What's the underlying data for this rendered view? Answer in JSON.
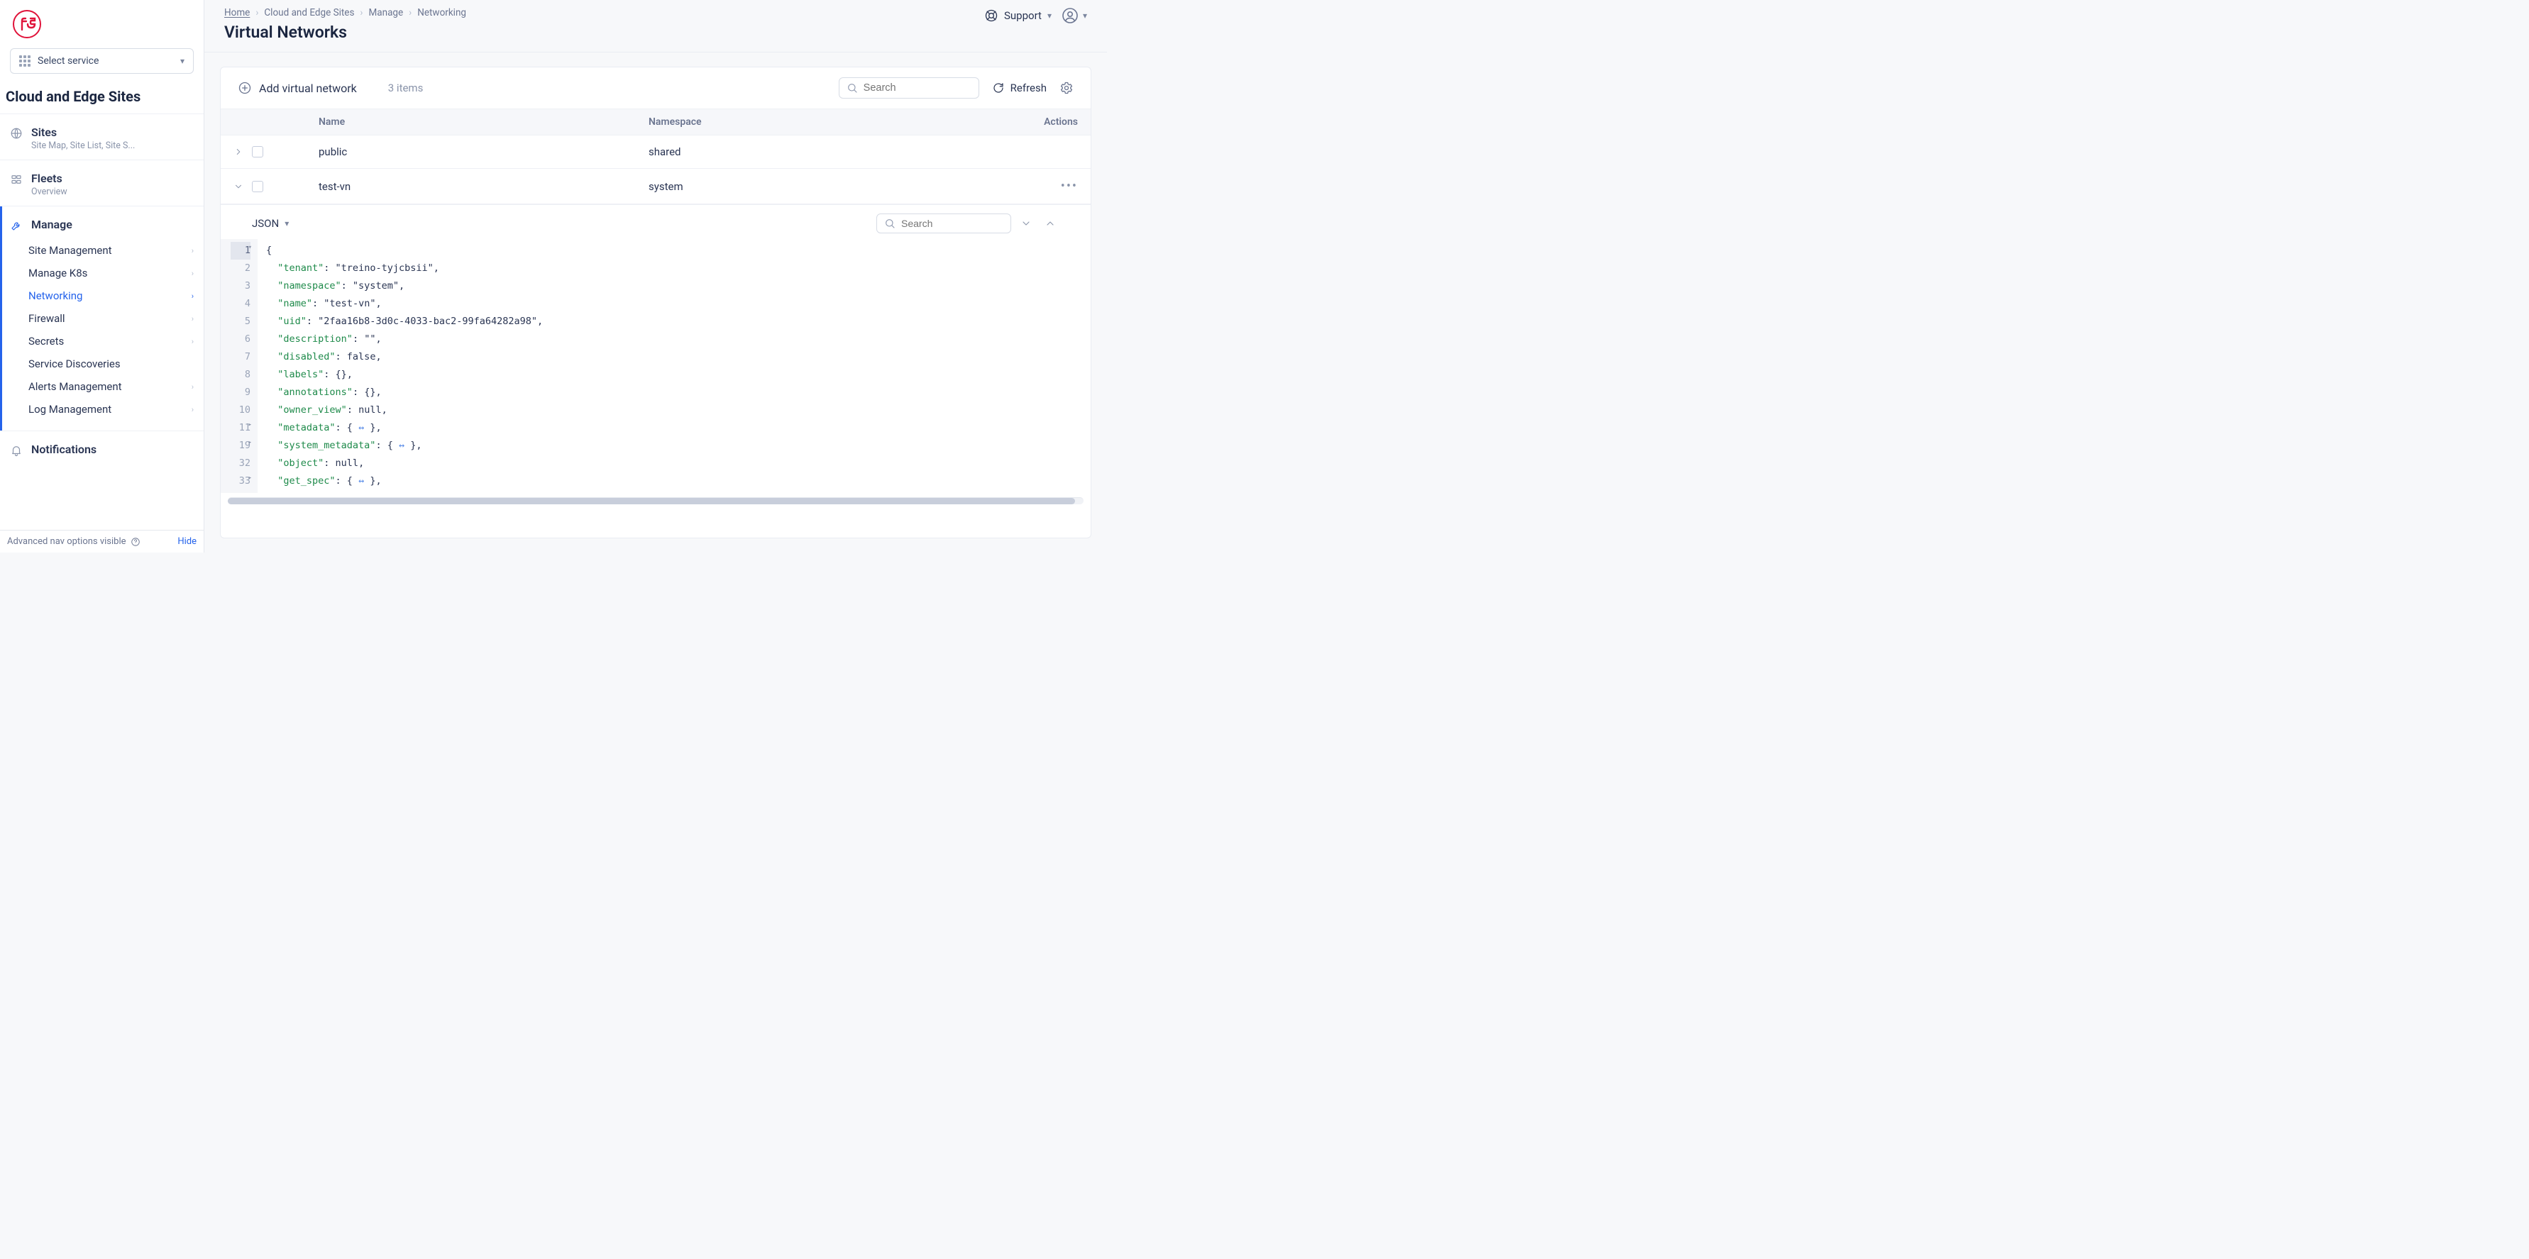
{
  "sidebar": {
    "service_selector_label": "Select service",
    "context_title": "Cloud and Edge Sites",
    "nav": [
      {
        "title": "Sites",
        "subtitle": "Site Map, Site List, Site S..."
      },
      {
        "title": "Fleets",
        "subtitle": "Overview"
      },
      {
        "title": "Manage",
        "children": [
          {
            "label": "Site Management",
            "chevron": true
          },
          {
            "label": "Manage K8s",
            "chevron": true
          },
          {
            "label": "Networking",
            "chevron": true,
            "active": true
          },
          {
            "label": "Firewall",
            "chevron": true
          },
          {
            "label": "Secrets",
            "chevron": true
          },
          {
            "label": "Service Discoveries",
            "chevron": false
          },
          {
            "label": "Alerts Management",
            "chevron": true
          },
          {
            "label": "Log Management",
            "chevron": true
          }
        ]
      },
      {
        "title": "Notifications"
      }
    ],
    "footer_text": "Advanced nav options visible",
    "footer_hide": "Hide"
  },
  "breadcrumbs": [
    "Home",
    "Cloud and Edge Sites",
    "Manage",
    "Networking"
  ],
  "page_title": "Virtual Networks",
  "header": {
    "support_label": "Support"
  },
  "toolbar": {
    "add_label": "Add virtual network",
    "count_label": "3 items",
    "search_placeholder": "Search",
    "refresh_label": "Refresh"
  },
  "table": {
    "columns": [
      "Name",
      "Namespace",
      "Actions"
    ],
    "rows": [
      {
        "name": "public",
        "namespace": "shared",
        "expanded": false,
        "actions": false
      },
      {
        "name": "test-vn",
        "namespace": "system",
        "expanded": true,
        "actions": true
      }
    ]
  },
  "detail": {
    "format_label": "JSON",
    "search_placeholder": "Search",
    "lines": [
      {
        "n": "1",
        "fold": "open",
        "text": "{"
      },
      {
        "n": "2",
        "fold": "",
        "text": "  \"tenant\": \"treino-tyjcbsii\","
      },
      {
        "n": "3",
        "fold": "",
        "text": "  \"namespace\": \"system\","
      },
      {
        "n": "4",
        "fold": "",
        "text": "  \"name\": \"test-vn\","
      },
      {
        "n": "5",
        "fold": "",
        "text": "  \"uid\": \"2faa16b8-3d0c-4033-bac2-99fa64282a98\","
      },
      {
        "n": "6",
        "fold": "",
        "text": "  \"description\": \"\","
      },
      {
        "n": "7",
        "fold": "",
        "text": "  \"disabled\": false,"
      },
      {
        "n": "8",
        "fold": "",
        "text": "  \"labels\": {},"
      },
      {
        "n": "9",
        "fold": "",
        "text": "  \"annotations\": {},"
      },
      {
        "n": "10",
        "fold": "",
        "text": "  \"owner_view\": null,"
      },
      {
        "n": "11",
        "fold": "closed",
        "text": "  \"metadata\": { ↔ },"
      },
      {
        "n": "19",
        "fold": "closed",
        "text": "  \"system_metadata\": { ↔ },"
      },
      {
        "n": "32",
        "fold": "",
        "text": "  \"object\": null,"
      },
      {
        "n": "33",
        "fold": "closed",
        "text": "  \"get_spec\": { ↔ },"
      }
    ]
  }
}
